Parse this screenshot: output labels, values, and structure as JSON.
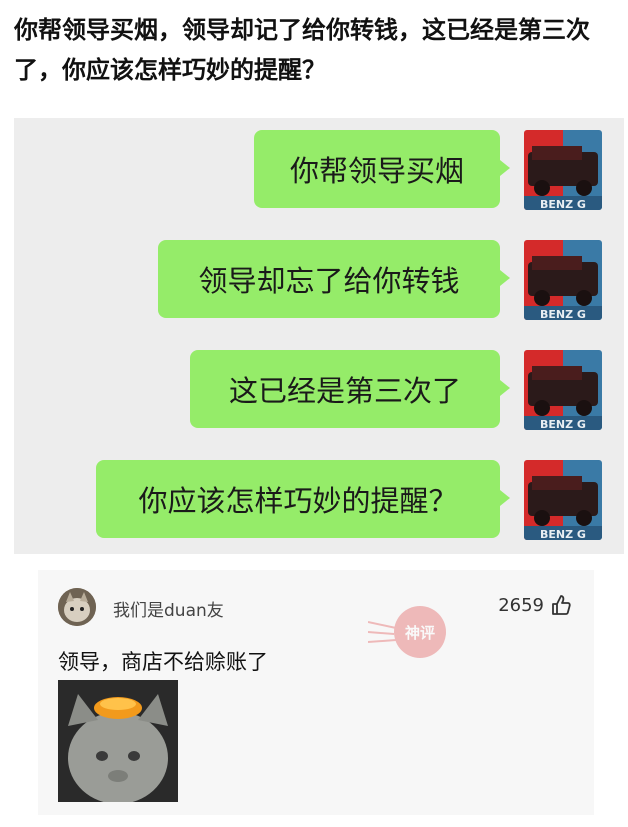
{
  "post": {
    "title": "你帮领导买烟，领导却记了给你转钱，这已经是第三次了，你应该怎样巧妙的提醒？"
  },
  "chat": {
    "messages": [
      {
        "text": "你帮领导买烟"
      },
      {
        "text": "领导却忘了给你转钱"
      },
      {
        "text": "这已经是第三次了"
      },
      {
        "text": "你应该怎样巧妙的提醒？"
      }
    ],
    "avatar_label": "BENZ G"
  },
  "comment": {
    "username": "我们是duan友",
    "likes": "2659",
    "text": "领导，商店不给赊账了",
    "stamp_text": "神评"
  },
  "colors": {
    "bubble": "#95ec69",
    "chat_bg": "#ededed",
    "avatar_red": "#d42a2a",
    "avatar_blue": "#3a7aa6"
  }
}
